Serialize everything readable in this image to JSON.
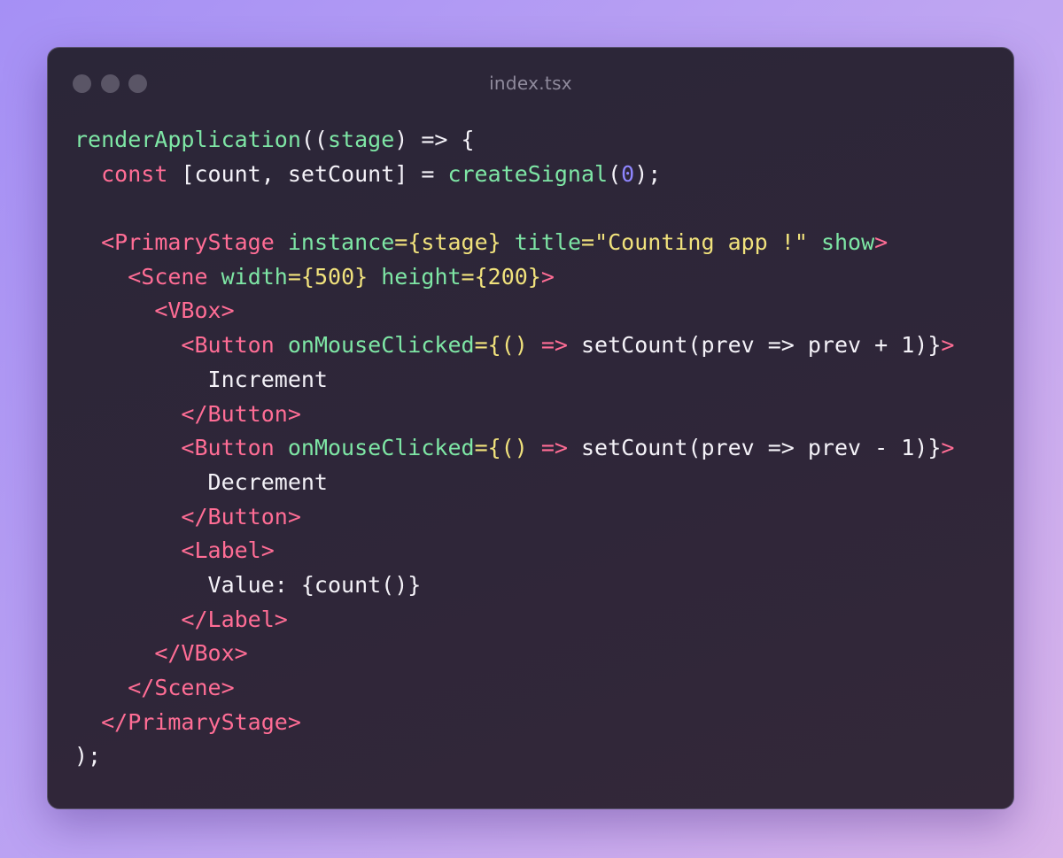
{
  "window": {
    "filename": "index.tsx"
  },
  "colors": {
    "function": "#7ee6a5",
    "keyword": "#ff6d95",
    "tag": "#ff6d95",
    "attribute": "#7ee6a5",
    "brace": "#f1e27c",
    "string": "#f1e27c",
    "number": "#8f86ff",
    "text": "#f4f2f8"
  },
  "code": {
    "lines": [
      [
        {
          "t": "fn",
          "v": "renderApplication"
        },
        {
          "t": "plain",
          "v": "(("
        },
        {
          "t": "fn",
          "v": "stage"
        },
        {
          "t": "plain",
          "v": ") => {"
        }
      ],
      [
        {
          "t": "plain",
          "v": "  "
        },
        {
          "t": "kw",
          "v": "const"
        },
        {
          "t": "plain",
          "v": " [count, setCount] = "
        },
        {
          "t": "fn",
          "v": "createSignal"
        },
        {
          "t": "plain",
          "v": "("
        },
        {
          "t": "num",
          "v": "0"
        },
        {
          "t": "plain",
          "v": ");"
        }
      ],
      [],
      [
        {
          "t": "plain",
          "v": "  "
        },
        {
          "t": "tag",
          "v": "<PrimaryStage"
        },
        {
          "t": "plain",
          "v": " "
        },
        {
          "t": "attr",
          "v": "instance"
        },
        {
          "t": "punc",
          "v": "={stage}"
        },
        {
          "t": "plain",
          "v": " "
        },
        {
          "t": "attr",
          "v": "title"
        },
        {
          "t": "str",
          "v": "=\"Counting app !\""
        },
        {
          "t": "plain",
          "v": " "
        },
        {
          "t": "attr",
          "v": "show"
        },
        {
          "t": "tag",
          "v": ">"
        }
      ],
      [
        {
          "t": "plain",
          "v": "    "
        },
        {
          "t": "tag",
          "v": "<Scene"
        },
        {
          "t": "plain",
          "v": " "
        },
        {
          "t": "attr",
          "v": "width"
        },
        {
          "t": "punc",
          "v": "={500}"
        },
        {
          "t": "plain",
          "v": " "
        },
        {
          "t": "attr",
          "v": "height"
        },
        {
          "t": "punc",
          "v": "={200}"
        },
        {
          "t": "tag",
          "v": ">"
        }
      ],
      [
        {
          "t": "plain",
          "v": "      "
        },
        {
          "t": "tag",
          "v": "<VBox>"
        }
      ],
      [
        {
          "t": "plain",
          "v": "        "
        },
        {
          "t": "tag",
          "v": "<Button"
        },
        {
          "t": "plain",
          "v": " "
        },
        {
          "t": "attr",
          "v": "onMouseClicked"
        },
        {
          "t": "punc",
          "v": "={()"
        },
        {
          "t": "plain",
          "v": " "
        },
        {
          "t": "kw",
          "v": "=>"
        },
        {
          "t": "plain",
          "v": " setCount(prev => prev + 1)}"
        },
        {
          "t": "tag",
          "v": ">"
        }
      ],
      [
        {
          "t": "plain",
          "v": "          Increment"
        }
      ],
      [
        {
          "t": "plain",
          "v": "        "
        },
        {
          "t": "tag",
          "v": "</Button>"
        }
      ],
      [
        {
          "t": "plain",
          "v": "        "
        },
        {
          "t": "tag",
          "v": "<Button"
        },
        {
          "t": "plain",
          "v": " "
        },
        {
          "t": "attr",
          "v": "onMouseClicked"
        },
        {
          "t": "punc",
          "v": "={()"
        },
        {
          "t": "plain",
          "v": " "
        },
        {
          "t": "kw",
          "v": "=>"
        },
        {
          "t": "plain",
          "v": " setCount(prev => prev - 1)}"
        },
        {
          "t": "tag",
          "v": ">"
        }
      ],
      [
        {
          "t": "plain",
          "v": "          Decrement"
        }
      ],
      [
        {
          "t": "plain",
          "v": "        "
        },
        {
          "t": "tag",
          "v": "</Button>"
        }
      ],
      [
        {
          "t": "plain",
          "v": "        "
        },
        {
          "t": "tag",
          "v": "<Label>"
        }
      ],
      [
        {
          "t": "plain",
          "v": "          Value: {count()}"
        }
      ],
      [
        {
          "t": "plain",
          "v": "        "
        },
        {
          "t": "tag",
          "v": "</Label>"
        }
      ],
      [
        {
          "t": "plain",
          "v": "      "
        },
        {
          "t": "tag",
          "v": "</VBox>"
        }
      ],
      [
        {
          "t": "plain",
          "v": "    "
        },
        {
          "t": "tag",
          "v": "</Scene>"
        }
      ],
      [
        {
          "t": "plain",
          "v": "  "
        },
        {
          "t": "tag",
          "v": "</PrimaryStage>"
        }
      ],
      [
        {
          "t": "plain",
          "v": ");"
        }
      ]
    ]
  }
}
